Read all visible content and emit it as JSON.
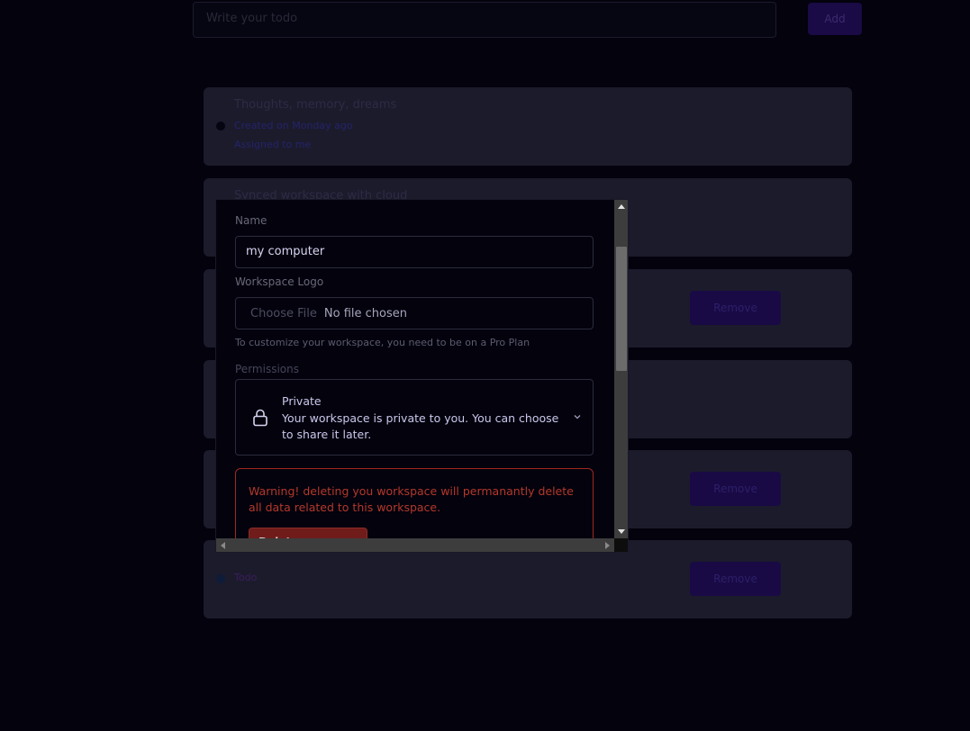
{
  "background": {
    "new_item_placeholder": "Write your todo",
    "add_label": "Add",
    "cards": [
      {
        "title": "Thoughts, memory, dreams",
        "line1": "Created on Monday ago",
        "line2": "Assigned to me"
      },
      {
        "title": "Synced workspace with cloud"
      }
    ],
    "remove_label": "Remove",
    "last_item_text": "Todo"
  },
  "modal": {
    "name_label": "Name",
    "name_value": "my computer",
    "logo_label": "Workspace Logo",
    "choose_file_label": "Choose File",
    "no_file_label": "No file chosen",
    "pro_hint": "To customize your workspace, you need to be on a Pro Plan",
    "permissions_label": "Permissions",
    "permission": {
      "title": "Private",
      "description": "Your workspace is private to you. You can choose to share it later."
    },
    "warning_text": "Warning! deleting you workspace will permanantly delete all data related to this workspace.",
    "delete_label": "Delete Workspace"
  },
  "icons": {
    "lock": "lock-icon",
    "chevron": "chevron-down-icon"
  },
  "colors": {
    "accent": "#5b21b6",
    "danger": "#b5382b",
    "background": "#03020d"
  }
}
